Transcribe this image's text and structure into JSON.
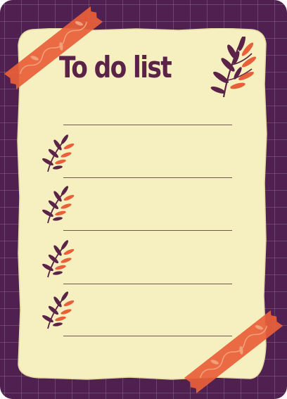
{
  "title": "To do list",
  "colors": {
    "background": "#4f2050",
    "paper": "#f6efbf",
    "tape": "#e8603a",
    "ink": "#5a2347",
    "leaf_orange": "#e8603a"
  },
  "tasks": [
    {
      "text": ""
    },
    {
      "text": ""
    },
    {
      "text": ""
    },
    {
      "text": ""
    }
  ],
  "decorations": {
    "title_icon": "leaf-sprig-icon",
    "task_icon": "leaf-sprig-icon",
    "tape_strips": 2
  }
}
